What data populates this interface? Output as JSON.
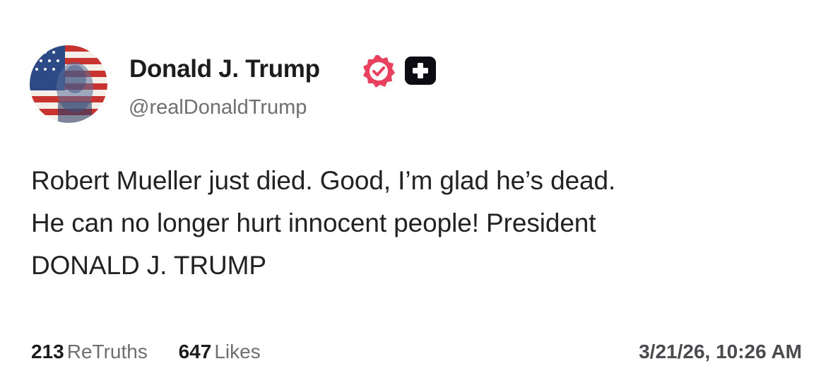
{
  "author": {
    "display_name": "Donald J. Trump",
    "handle": "@realDonaldTrump",
    "avatar_icon": "flag-portrait-avatar",
    "verified_icon": "verified-badge-icon",
    "plus_icon": "plus-badge-icon",
    "verified_color": "#e8415f"
  },
  "post": {
    "lines": [
      "Robert Mueller just died. Good, I’m glad he’s dead.",
      "He can no longer hurt innocent people! President",
      "DONALD J. TRUMP"
    ]
  },
  "stats": {
    "retruths_count": "213",
    "retruths_label": "ReTruths",
    "likes_count": "647",
    "likes_label": "Likes"
  },
  "timestamp": "3/21/26, 10:26 AM"
}
